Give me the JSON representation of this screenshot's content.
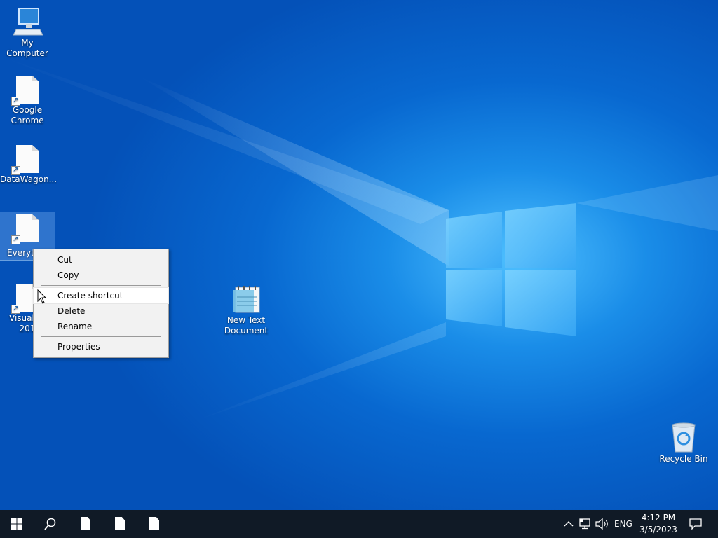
{
  "desktop": {
    "icons": [
      {
        "label": "My Computer"
      },
      {
        "label_line1": "Google",
        "label_line2": "Chrome"
      },
      {
        "label": "DataWagon..."
      },
      {
        "label": "Everyth"
      },
      {
        "label_line1": "Visual St",
        "label_line2": "201"
      },
      {
        "label_line1": "New Text",
        "label_line2": "Document"
      },
      {
        "label": "Recycle Bin"
      }
    ]
  },
  "context_menu": {
    "items": {
      "cut": "Cut",
      "copy": "Copy",
      "create_shortcut": "Create shortcut",
      "delete": "Delete",
      "rename": "Rename",
      "properties": "Properties"
    },
    "highlighted": "Create shortcut"
  },
  "taskbar": {
    "start_icon": "windows-logo-icon",
    "search_icon": "search-icon",
    "pinned": [
      "document-icon",
      "document-icon",
      "document-icon"
    ],
    "tray": {
      "language": "ENG",
      "time": "4:12 PM",
      "date": "3/5/2023"
    }
  },
  "colors": {
    "taskbar": "#101a26",
    "wallpaper_accent": "#1a8de8"
  }
}
